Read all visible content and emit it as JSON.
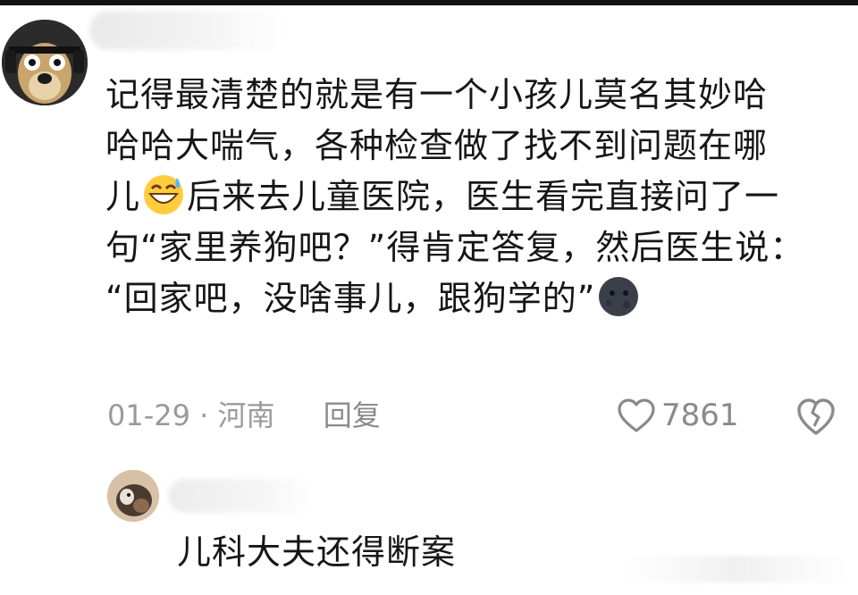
{
  "comment": {
    "lines": [
      "记得最清楚的就是有一个小孩儿莫名其妙哈",
      "哈哈大喘气，各种检查做了找不到问题在哪",
      "后来去儿童医院，医生看完直接问了一",
      "句“家里养狗吧？”得肯定答复，然后医生说：",
      "“回家吧，没啥事儿，跟狗学的”"
    ],
    "line3_prefix": "儿",
    "emoji_sweat_icon": "grinning-sweat-emoji",
    "emoji_moon_icon": "new-moon-face-emoji",
    "date": "01-29",
    "separator": "·",
    "location": "河南",
    "reply_label": "回复",
    "like_count": "7861"
  },
  "reply": {
    "text": "儿科大夫还得断案"
  },
  "colors": {
    "text": "#161616",
    "meta": "#9a9a9a",
    "icon": "#8a8a8a",
    "background": "#ffffff"
  }
}
